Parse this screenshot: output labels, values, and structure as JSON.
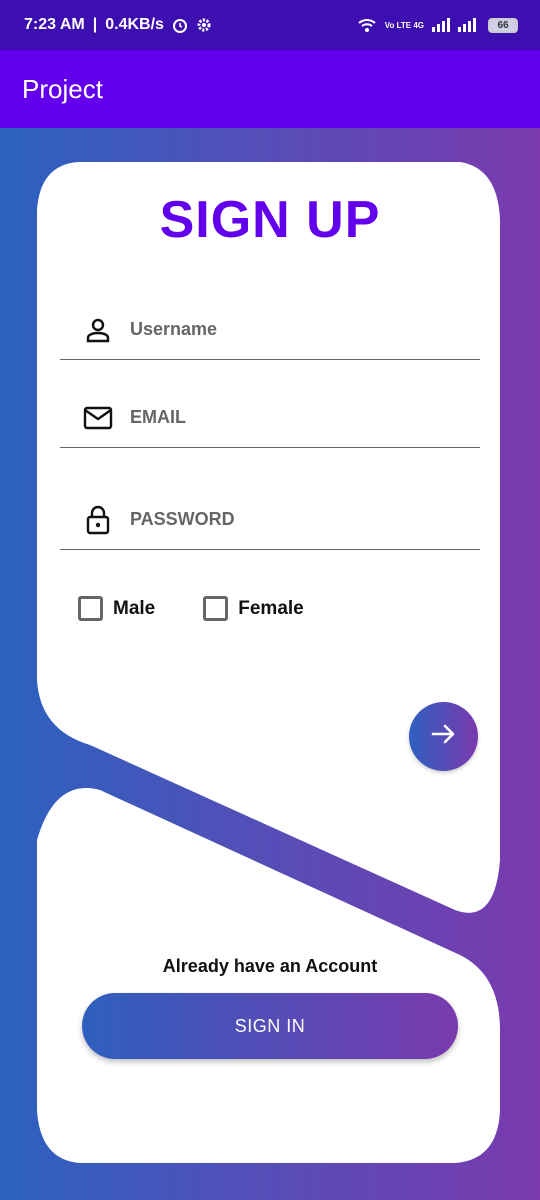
{
  "status_bar": {
    "time": "7:23 AM",
    "speed": "0.4KB/s",
    "network": "Vo LTE 4G",
    "battery": "66"
  },
  "app_bar": {
    "title": "Project"
  },
  "form": {
    "heading": "SIGN UP",
    "username_placeholder": "Username",
    "email_placeholder": "EMAIL",
    "password_placeholder": "PASSWORD",
    "gender_options": [
      "Male",
      "Female"
    ],
    "submit_icon": "arrow-right-icon"
  },
  "signin": {
    "prompt": "Already have an Account",
    "button_label": "SIGN IN"
  },
  "colors": {
    "primary": "#6200ee",
    "status_bar": "#3d0fb0",
    "gradient_start": "#2f5fbf",
    "gradient_end": "#7a3aae"
  }
}
